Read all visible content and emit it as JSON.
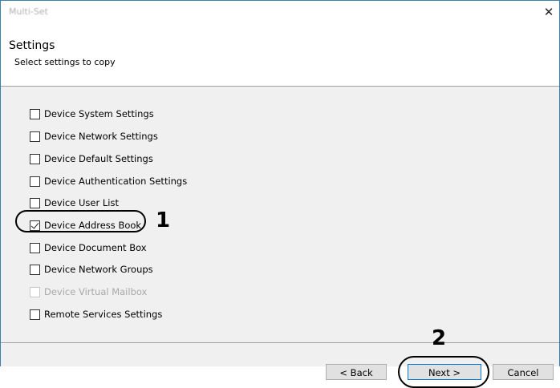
{
  "window": {
    "title": "Multi-Set",
    "close_label": "✕"
  },
  "header": {
    "title": "Settings",
    "subtitle": "Select settings to copy"
  },
  "options": [
    {
      "label": "Device System Settings",
      "checked": false,
      "enabled": true
    },
    {
      "label": "Device Network Settings",
      "checked": false,
      "enabled": true
    },
    {
      "label": "Device Default Settings",
      "checked": false,
      "enabled": true
    },
    {
      "label": "Device Authentication Settings",
      "checked": false,
      "enabled": true
    },
    {
      "label": "Device User List",
      "checked": false,
      "enabled": true
    },
    {
      "label": "Device Address Book",
      "checked": true,
      "enabled": true
    },
    {
      "label": "Device Document Box",
      "checked": false,
      "enabled": true
    },
    {
      "label": "Device Network Groups",
      "checked": false,
      "enabled": true
    },
    {
      "label": "Device Virtual Mailbox",
      "checked": false,
      "enabled": false
    },
    {
      "label": "Remote Services Settings",
      "checked": false,
      "enabled": true
    }
  ],
  "callouts": {
    "step1": "1",
    "step2": "2"
  },
  "buttons": {
    "back": "< Back",
    "next": "Next >",
    "cancel": "Cancel"
  }
}
